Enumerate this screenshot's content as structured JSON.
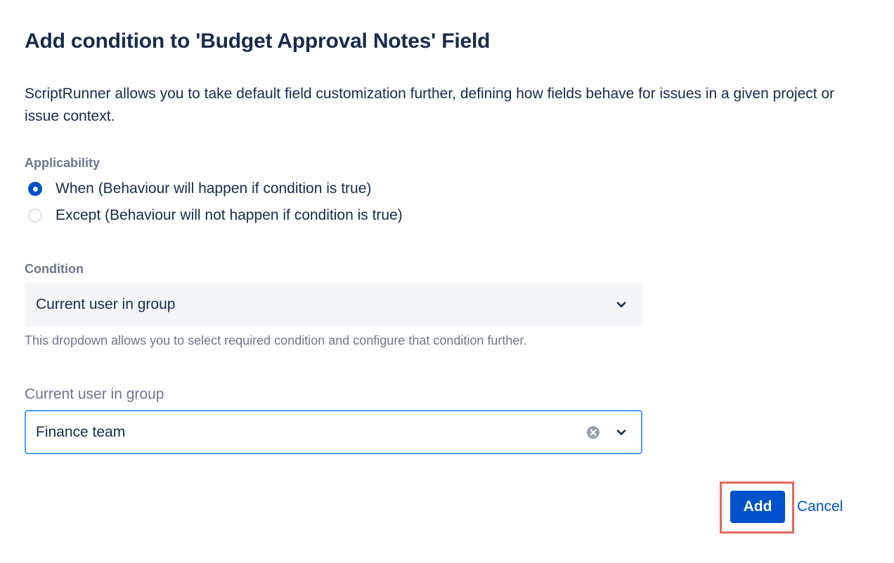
{
  "dialog": {
    "title": "Add condition to 'Budget Approval Notes' Field",
    "description": "ScriptRunner allows you to take default field customization further, defining how fields behave for issues in a given project or issue context."
  },
  "applicability": {
    "label": "Applicability",
    "options": [
      {
        "label": "When (Behaviour will happen if condition is true)",
        "checked": true
      },
      {
        "label": "Except (Behaviour will not happen if condition is true)",
        "checked": false
      }
    ]
  },
  "condition": {
    "label": "Condition",
    "selected": "Current user in group",
    "helper": "This dropdown allows you to select required condition and configure that condition further."
  },
  "group": {
    "label": "Current user in group",
    "selected": "Finance team"
  },
  "actions": {
    "add_label": "Add",
    "cancel_label": "Cancel"
  },
  "icons": {
    "chevron": "chevron-down-icon",
    "clear": "clear-icon"
  },
  "colors": {
    "primary": "#0052cc",
    "text": "#172b4d",
    "subtle": "#6b778c",
    "focus_border": "#4c9aff",
    "highlight": "#e5675b"
  }
}
